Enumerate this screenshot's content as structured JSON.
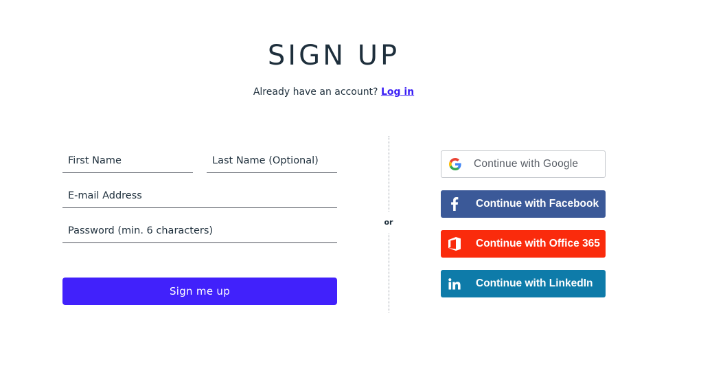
{
  "header": {
    "title": "SIGN UP",
    "account_prompt": "Already have an account?",
    "login_link": "Log in"
  },
  "form": {
    "first_name": {
      "value": "",
      "placeholder": "First Name"
    },
    "last_name": {
      "value": "",
      "placeholder": "Last Name (Optional)"
    },
    "email": {
      "value": "",
      "placeholder": "E-mail Address"
    },
    "password": {
      "value": "",
      "placeholder": "Password (min. 6 characters)"
    },
    "submit_label": "Sign me up"
  },
  "divider": {
    "label": "or"
  },
  "sso": {
    "google": {
      "label": "Continue with Google",
      "icon": "google-icon"
    },
    "facebook": {
      "label": "Continue with Facebook",
      "icon": "facebook-icon",
      "color": "#3b5998"
    },
    "office": {
      "label": "Continue with Office 365",
      "icon": "office-icon",
      "color": "#fa2b0c"
    },
    "linkedin": {
      "label": "Continue with LinkedIn",
      "icon": "linkedin-icon",
      "color": "#0e7ba9"
    }
  },
  "colors": {
    "accent": "#4121fb",
    "link": "#3b1ff5",
    "text": "#1e2f3c"
  }
}
